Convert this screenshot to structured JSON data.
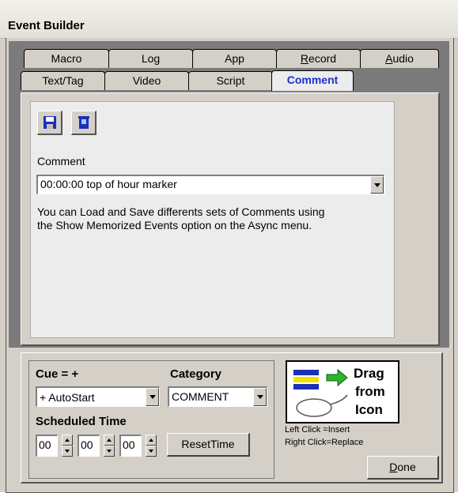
{
  "window": {
    "title": "Event Builder"
  },
  "tabs_back": [
    {
      "label": "Macro"
    },
    {
      "label": "Log"
    },
    {
      "label": "App"
    },
    {
      "label_prefix": "",
      "label_under": "R",
      "label_rest": "ecord"
    },
    {
      "label_prefix": "",
      "label_under": "A",
      "label_rest": "udio"
    }
  ],
  "tabs_front": [
    {
      "label": "Text/Tag"
    },
    {
      "label": "Video"
    },
    {
      "label": "Script"
    },
    {
      "label": "Comment",
      "active": true
    }
  ],
  "comment": {
    "save_icon": "floppy-disk-icon",
    "delete_icon": "trash-icon",
    "field_label": "Comment",
    "value": "00:00:00 top of hour marker",
    "help_line1": "You can Load and Save differents sets of Comments using",
    "help_line2": "the Show Memorized Events option on the Async menu."
  },
  "cue": {
    "label": "Cue = +",
    "value": "+ AutoStart",
    "category_label": "Category",
    "category_value": "COMMENT",
    "scheduled_label": "Scheduled Time",
    "hours": "00",
    "minutes": "00",
    "seconds": "00",
    "reset_label": "ResetTime"
  },
  "drag": {
    "line1": "Drag",
    "line2": "from",
    "line3": "Icon",
    "hint1": "Left Click  =Insert",
    "hint2": "Right Click=Replace",
    "icon": "event-mouse-icon"
  },
  "done": {
    "under": "D",
    "rest": "one"
  },
  "colors": {
    "active_tab": "#1c2fd0",
    "face": "#d4d0c8",
    "arrow_green": "#2db52d"
  }
}
